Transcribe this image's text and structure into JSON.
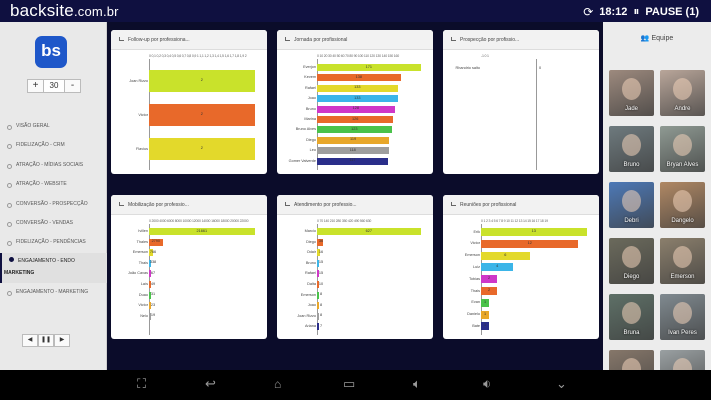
{
  "topbar": {
    "brand": "backsite",
    "brand_domain": ".com.br",
    "time": "18:12",
    "pause_label": "PAUSE (1)",
    "refresh_icon": "refresh-icon",
    "pause_icon": "pause-icon"
  },
  "sidebar": {
    "logo_text": "bs",
    "zoom": {
      "plus": "+",
      "value": "30",
      "minus": "-"
    },
    "items": [
      {
        "label": "VISÃO GERAL"
      },
      {
        "label": "FIDELIZAÇÃO - CRM"
      },
      {
        "label": "ATRAÇÃO - MÍDIAS SOCIAIS"
      },
      {
        "label": "ATRAÇÃO - WEBSITE"
      },
      {
        "label": "CONVERSÃO - PROSPECÇÃO"
      },
      {
        "label": "CONVERSÃO - VENDAS"
      },
      {
        "label": "FIDELIZAÇÃO - PENDÊNCIAS"
      },
      {
        "label": "ENGAJAMENTO - ENDO",
        "label2": "MARKETING",
        "active": true
      },
      {
        "label": "ENGAJAMENTO - MARKETING"
      }
    ],
    "pager": {
      "prev": "◀",
      "pause": "❚❚",
      "next": "▶"
    }
  },
  "charts": [
    {
      "title": "Follow-up por professiona...",
      "axis": "0  0,1  0,2  0,3  0,4  0,5  0,6  0,7  0,8  0,9  1  1,1  1,2  1,3  1,4  1,5  1,6  1,7  1,8  1,9  2",
      "rows": [
        {
          "label": "Joan Rizzo",
          "value": "2",
          "color": "#c9e22b"
        },
        {
          "label": "Victor",
          "value": "2",
          "color": "#e8692a"
        },
        {
          "label": "Flavius",
          "value": "2",
          "color": "#e3d92b"
        }
      ]
    },
    {
      "title": "Jornada por profissional",
      "axis": "0  10  20  30  40  50  60  70  80  90  100  110  120  130  140  150  160",
      "rows": [
        {
          "label": "Everjon",
          "value": "171",
          "color": "#c9e22b"
        },
        {
          "label": "Kevem",
          "value": "138",
          "color": "#e8692a"
        },
        {
          "label": "Rafael",
          "value": "133",
          "color": "#e3d92b"
        },
        {
          "label": "Joao",
          "value": "133",
          "color": "#3bb5e8"
        },
        {
          "label": "Bruno",
          "value": "128",
          "color": "#cf37c8"
        },
        {
          "label": "Marina",
          "value": "126",
          "color": "#e8692a"
        },
        {
          "label": "Bruno Alves",
          "value": "123",
          "color": "#4ac24a"
        },
        {
          "label": "Diego",
          "value": "119",
          "color": "#e8a72a"
        },
        {
          "label": "Leo",
          "value": "118",
          "color": "#9e9e9e"
        },
        {
          "label": "Gomer Valverde",
          "value": "117",
          "color": "#2a2e8a"
        }
      ]
    },
    {
      "title": "Prospecção por profissio...",
      "axis": "-1                    0                    1",
      "rows": [
        {
          "label": "Rhandrio salto",
          "value": "0",
          "color": "#c9e22b"
        }
      ]
    },
    {
      "title": "Mobilização por professio...",
      "axis": "0  2000  4000  6000  8000  10000  12000  14000  16000  18000  20000  22000",
      "rows": [
        {
          "label": "Ivillen",
          "value": "21661",
          "color": "#c9e22b"
        },
        {
          "label": "Thales",
          "value": "2790",
          "color": "#e8692a"
        },
        {
          "label": "Emerson",
          "value": "766",
          "color": "#e3d92b"
        },
        {
          "label": "Thais",
          "value": "338",
          "color": "#3bb5e8"
        },
        {
          "label": "João Cavas",
          "value": "67",
          "color": "#cf37c8"
        },
        {
          "label": "Laís",
          "value": "49",
          "color": "#e8692a"
        },
        {
          "label": "Duao",
          "value": "31",
          "color": "#4ac24a"
        },
        {
          "label": "Victor",
          "value": "23",
          "color": "#e8a72a"
        },
        {
          "label": "Nelo",
          "value": "19",
          "color": "#9e9e9e"
        }
      ]
    },
    {
      "title": "Atendimento por professio...",
      "axis": "0  70  140  210  280  350  420  490  560  630",
      "rows": [
        {
          "label": "Marcio",
          "value": "627",
          "color": "#c9e22b"
        },
        {
          "label": "Diego",
          "value": "36",
          "color": "#e8692a"
        },
        {
          "label": "Odair",
          "value": "16",
          "color": "#e3d92b"
        },
        {
          "label": "Bruno",
          "value": "15",
          "color": "#3bb5e8"
        },
        {
          "label": "Rafael",
          "value": "15",
          "color": "#cf37c8"
        },
        {
          "label": "Dalta",
          "value": "10",
          "color": "#e8692a"
        },
        {
          "label": "Emerson",
          "value": "8",
          "color": "#4ac24a"
        },
        {
          "label": "Joao",
          "value": "8",
          "color": "#e8a72a"
        },
        {
          "label": "Joan Rizzo",
          "value": "8",
          "color": "#9e9e9e"
        },
        {
          "label": "Ariana",
          "value": "7",
          "color": "#2a2e8a"
        }
      ]
    },
    {
      "title": "Reuniões por profissional",
      "axis": "0  1  2  3  4  5  6  7  8  9  10  11  12  13  14  15  16  17  18  19",
      "rows": [
        {
          "label": "Erik",
          "value": "13",
          "color": "#c9e22b"
        },
        {
          "label": "Victor",
          "value": "12",
          "color": "#e8692a"
        },
        {
          "label": "Emerson",
          "value": "6",
          "color": "#e3d92b"
        },
        {
          "label": "Luiz",
          "value": "4",
          "color": "#3bb5e8"
        },
        {
          "label": "Tobias",
          "value": "2",
          "color": "#cf37c8"
        },
        {
          "label": "Thais",
          "value": "2",
          "color": "#e8692a"
        },
        {
          "label": "Evan",
          "value": "1",
          "color": "#4ac24a"
        },
        {
          "label": "Danielo",
          "value": "1",
          "color": "#e8a72a"
        },
        {
          "label": "Bate",
          "value": "1",
          "color": "#2a2e8a"
        }
      ]
    }
  ],
  "team": {
    "title": "Equipe",
    "icon": "users-icon",
    "members": [
      {
        "name": "Jade",
        "color": "#9d8a7e"
      },
      {
        "name": "Andre",
        "color": "#b9a69a"
      },
      {
        "name": "Bruno",
        "color": "#6e7a7e"
      },
      {
        "name": "Bryan Alves",
        "color": "#8f9a93"
      },
      {
        "name": "Debri",
        "color": "#4d79b7"
      },
      {
        "name": "Dangelo",
        "color": "#b08864"
      },
      {
        "name": "Diego",
        "color": "#6b6a5c"
      },
      {
        "name": "Emerson",
        "color": "#8b7f6c"
      },
      {
        "name": "Bruna",
        "color": "#5e7067"
      },
      {
        "name": "Ivan Peres",
        "color": "#808a90"
      },
      {
        "name": "",
        "color": "#86776a"
      },
      {
        "name": "",
        "color": "#9aa0a2"
      }
    ]
  },
  "navbar": {
    "icons": [
      "screenshot-icon",
      "back-icon",
      "home-icon",
      "recents-icon",
      "volume-down-icon",
      "volume-up-icon",
      "collapse-icon"
    ]
  }
}
